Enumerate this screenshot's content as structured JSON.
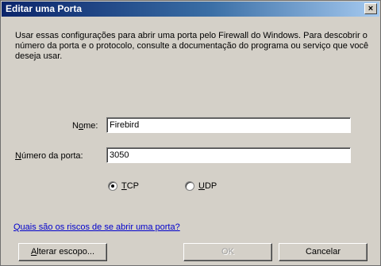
{
  "window": {
    "title": "Editar uma Porta",
    "close_glyph": "×"
  },
  "description": "Usar essas configurações para abrir uma porta pelo Firewall do Windows. Para descobrir o número da porta e o protocolo, consulte a documentação do programa ou serviço que você deseja usar.",
  "name_field": {
    "label": "Nome:",
    "value": "Firebird"
  },
  "port_field": {
    "label": "Número da porta:",
    "value": "3050"
  },
  "protocol": {
    "options": [
      "TCP",
      "UDP"
    ],
    "selected": "TCP"
  },
  "risk_link": "Quais são os riscos de se abrir uma porta?",
  "buttons": {
    "change_scope": "Alterar escopo...",
    "ok": "OK",
    "cancel": "Cancelar"
  }
}
